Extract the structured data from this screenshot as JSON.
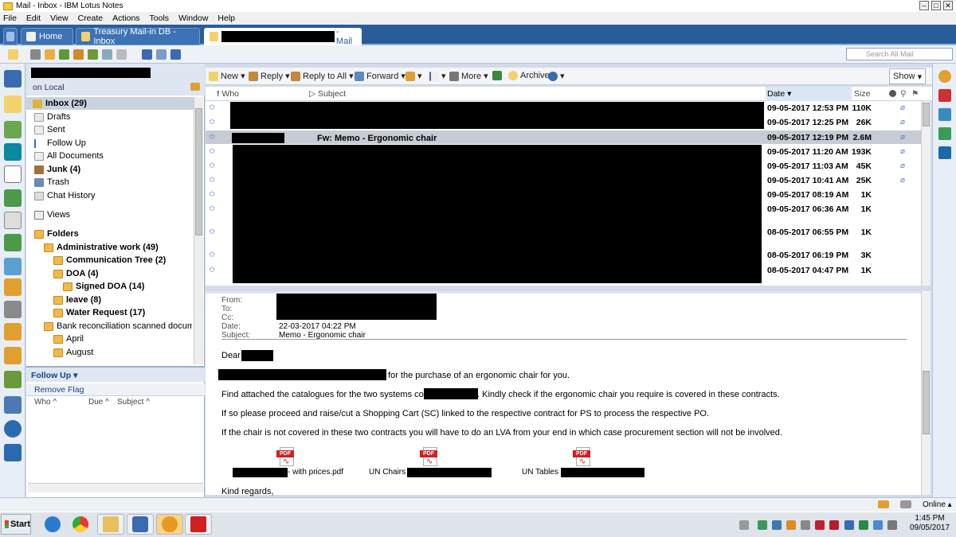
{
  "window": {
    "title": "Mail - Inbox - IBM Lotus Notes"
  },
  "menu": [
    "File",
    "Edit",
    "View",
    "Create",
    "Actions",
    "Tools",
    "Window",
    "Help"
  ],
  "tabs": [
    {
      "label": "Home"
    },
    {
      "label": "Treasury Mail-in DB - Inbox"
    },
    {
      "label": "- Mail"
    }
  ],
  "search": {
    "placeholder": "Search All Mail"
  },
  "nav": {
    "location": "on Local",
    "items": [
      {
        "label": "Inbox (29)",
        "bold": true
      },
      {
        "label": "Drafts"
      },
      {
        "label": "Sent"
      },
      {
        "label": "Follow Up"
      },
      {
        "label": "All Documents"
      },
      {
        "label": "Junk (4)"
      },
      {
        "label": "Trash"
      },
      {
        "label": "Chat History"
      }
    ],
    "views": "Views",
    "folders_label": "Folders",
    "folders": [
      {
        "label": "Administrative work (49)",
        "bold": true
      },
      {
        "label": "Communication Tree (2)",
        "bold": true
      },
      {
        "label": "DOA (4)",
        "bold": true
      },
      {
        "label": "Signed DOA (14)",
        "bold": true
      },
      {
        "label": "leave (8)",
        "bold": true
      },
      {
        "label": "Water Request (17)",
        "bold": true
      },
      {
        "label": "Bank reconciliation scanned documents"
      },
      {
        "label": "April"
      },
      {
        "label": "August"
      }
    ]
  },
  "followup": {
    "title": "Follow Up",
    "remove": "Remove Flag",
    "cols": [
      "Who",
      "Due",
      "Subject"
    ]
  },
  "actions": {
    "new": "New",
    "reply": "Reply",
    "reply_all": "Reply to All",
    "forward": "Forward",
    "more": "More",
    "archive": "Archive",
    "show": "Show"
  },
  "list": {
    "headers": {
      "who": "Who",
      "subject": "Subject",
      "date": "Date",
      "size": "Size"
    },
    "rows": [
      {
        "date": "09-05-2017 12:53 PM",
        "size": "110K",
        "att": true
      },
      {
        "date": "09-05-2017 12:25 PM",
        "size": "26K",
        "att": true
      },
      {
        "date": "09-05-2017 12:19 PM",
        "size": "2.6M",
        "att": true,
        "subject": "Fw: Memo - Ergonomic chair",
        "selected": true
      },
      {
        "date": "09-05-2017 11:20 AM",
        "size": "193K",
        "att": true
      },
      {
        "date": "09-05-2017 11:03 AM",
        "size": "45K",
        "att": true
      },
      {
        "date": "09-05-2017 10:41 AM",
        "size": "25K",
        "att": true
      },
      {
        "date": "09-05-2017 08:19 AM",
        "size": "1K",
        "att": false
      },
      {
        "date": "09-05-2017 06:36 AM",
        "size": "1K",
        "att": false
      },
      {
        "date": "08-05-2017 06:55 PM",
        "size": "1K",
        "att": false
      },
      {
        "date": "08-05-2017 06:19 PM",
        "size": "3K",
        "att": false
      },
      {
        "date": "08-05-2017 04:47 PM",
        "size": "1K",
        "att": false
      }
    ]
  },
  "preview": {
    "labels": {
      "from": "From:",
      "to": "To:",
      "cc": "Cc:",
      "date": "Date:",
      "subject": "Subject:"
    },
    "date": "22-03-2017 04:22 PM",
    "subject": "Memo - Ergonomic chair",
    "greeting": "Dear",
    "p1": "for the purchase of an ergonomic chair for you.",
    "p2a": "Find attached the catalogues for the two systems contract",
    "p2b": ". Kindly check if the ergonomic chair you require is covered in these contracts.",
    "p3": "If so please proceed and raise/cut a Shopping Cart (SC) linked to the respective contract for PS to process the respective PO.",
    "p4": "If the chair is not covered in these two contracts you will have to do an LVA from your end in which case procurement section will not be involved.",
    "att1": "- with prices.pdf",
    "att2": "UN Chairs -",
    "att3": "UN Tables -",
    "closing": "Kind regards,"
  },
  "status": {
    "online": "Online"
  },
  "taskbar": {
    "start": "Start",
    "time": "1:45 PM",
    "date": "09/05/2017"
  }
}
